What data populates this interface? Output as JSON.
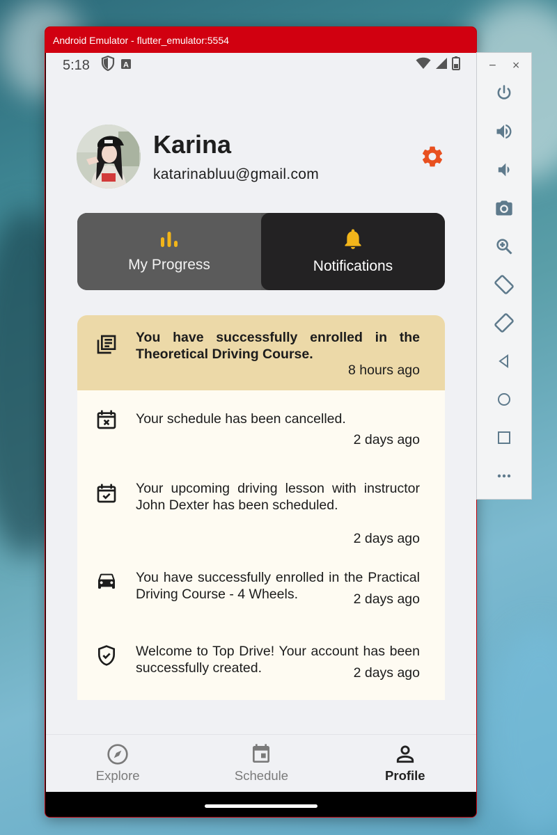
{
  "window": {
    "title": "Android Emulator - flutter_emulator:5554"
  },
  "status_bar": {
    "time": "5:18"
  },
  "profile": {
    "name": "Karina",
    "email": "katarinabluu@gmail.com"
  },
  "tabs": [
    {
      "label": "My Progress",
      "icon": "bar-chart-icon",
      "active": false
    },
    {
      "label": "Notifications",
      "icon": "bell-icon",
      "active": true
    }
  ],
  "notifications": [
    {
      "icon": "article-icon",
      "text": "You have successfully enrolled in the Theoretical Driving Course.",
      "time": "8 hours ago",
      "highlighted": true
    },
    {
      "icon": "calendar-cancel-icon",
      "text": "Your schedule has been cancelled.",
      "time": "2 days ago",
      "highlighted": false
    },
    {
      "icon": "calendar-check-icon",
      "text": "Your upcoming driving lesson with instructor John Dexter has been scheduled.",
      "time": "2 days ago",
      "highlighted": false
    },
    {
      "icon": "car-icon",
      "text": "You have successfully enrolled in the Practical Driving Course - 4 Wheels.",
      "time": "2 days ago",
      "highlighted": false
    },
    {
      "icon": "shield-check-icon",
      "text": "Welcome to Top Drive! Your account has been successfully created.",
      "time": "2 days ago",
      "highlighted": false
    }
  ],
  "bottom_nav": [
    {
      "label": "Explore",
      "icon": "compass-icon",
      "active": false
    },
    {
      "label": "Schedule",
      "icon": "calendar-icon",
      "active": false
    },
    {
      "label": "Profile",
      "icon": "person-icon",
      "active": true
    }
  ],
  "toolbar": {
    "minimize": "−",
    "close": "×",
    "buttons": [
      "power-icon",
      "volume-up-icon",
      "volume-down-icon",
      "camera-icon",
      "zoom-icon",
      "rotate-left-icon",
      "rotate-right-icon",
      "back-icon",
      "home-icon",
      "overview-icon",
      "more-icon"
    ]
  },
  "colors": {
    "accent_orange": "#e8501f",
    "tab_icon_yellow": "#f2b51a",
    "highlight_bg": "#ecd9a8",
    "list_bg": "#fefbf2",
    "title_bar_red": "#d10010"
  }
}
